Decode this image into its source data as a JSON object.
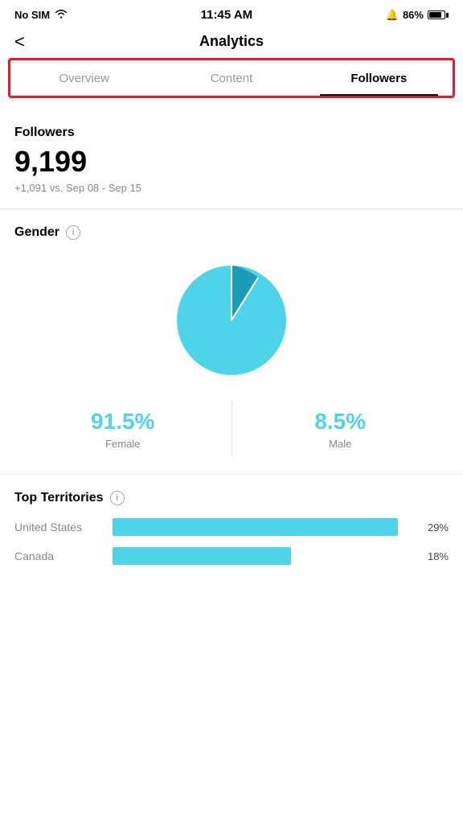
{
  "statusBar": {
    "carrier": "No SIM",
    "time": "11:45 AM",
    "alarm": "⏰",
    "battery": "86%"
  },
  "header": {
    "backLabel": "<",
    "title": "Analytics"
  },
  "tabs": [
    {
      "id": "overview",
      "label": "Overview",
      "active": false
    },
    {
      "id": "content",
      "label": "Content",
      "active": false
    },
    {
      "id": "followers",
      "label": "Followers",
      "active": true
    }
  ],
  "followersSection": {
    "title": "Followers",
    "count": "9,199",
    "delta": "+1,091 vs. Sep 08 - Sep 15"
  },
  "genderSection": {
    "title": "Gender",
    "infoIcon": "i",
    "female": {
      "pct": "91.5%",
      "label": "Female",
      "value": 91.5
    },
    "male": {
      "pct": "8.5%",
      "label": "Male",
      "value": 8.5
    }
  },
  "topTerritories": {
    "title": "Top Territories",
    "infoIcon": "i",
    "items": [
      {
        "name": "United States",
        "pct": "29%",
        "value": 29
      },
      {
        "name": "Canada",
        "pct": "18%",
        "value": 18
      }
    ],
    "maxValue": 30
  }
}
